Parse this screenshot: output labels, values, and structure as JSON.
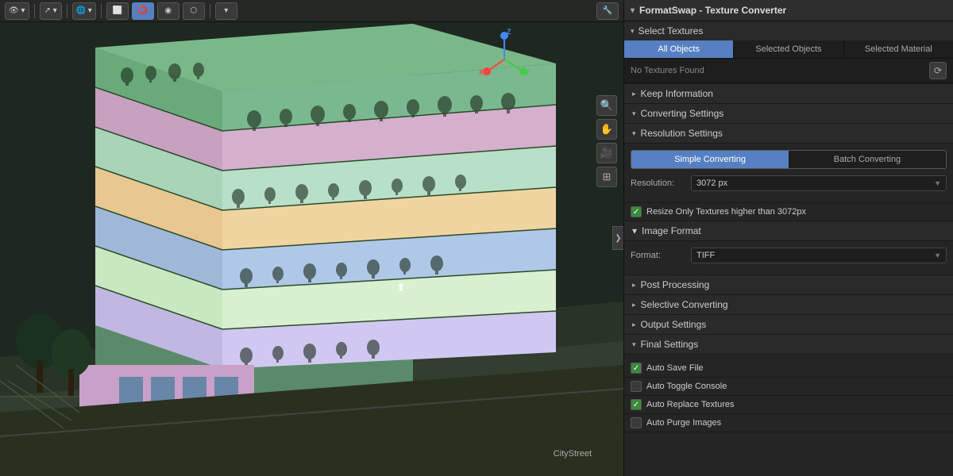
{
  "viewport": {
    "scene_label": "CityStreet"
  },
  "toolbar": {
    "buttons": [
      "👁",
      "↗",
      "🌐",
      "⬜",
      "⭕",
      "◉",
      "⬡",
      "🔧"
    ]
  },
  "sidebar_icons": [
    "🔍",
    "✋",
    "🎥",
    "⊞"
  ],
  "right_panel": {
    "title": "FormatSwap - Texture Converter",
    "select_textures_label": "Select Textures",
    "tabs": [
      {
        "label": "All Objects",
        "active": true
      },
      {
        "label": "Selected Objects",
        "active": false
      },
      {
        "label": "Selected Material",
        "active": false
      }
    ],
    "no_textures_label": "No Textures Found",
    "refresh_icon": "⟳",
    "keep_information_label": "Keep Information",
    "converting_settings_label": "Converting Settings",
    "resolution_settings_label": "Resolution Settings",
    "sub_tabs": [
      {
        "label": "Simple Converting",
        "active": true
      },
      {
        "label": "Batch Converting",
        "active": false
      }
    ],
    "resolution_label": "Resolution:",
    "resolution_value": "3072 px",
    "resize_only_label": "Resize Only Textures higher than 3072px",
    "image_format_label": "Image Format",
    "format_label": "Format:",
    "format_value": "TIFF",
    "format_chevron": "▼",
    "post_processing_label": "Post Processing",
    "selective_converting_label": "Selective Converting",
    "output_settings_label": "Output Settings",
    "final_settings_label": "Final Settings",
    "auto_save_file_label": "Auto Save File",
    "auto_toggle_console_label": "Auto Toggle Console",
    "auto_replace_textures_label": "Auto Replace Textures",
    "auto_purge_images_label": "Auto Purge Images",
    "chevron_down": "▼",
    "chevron_right": "▶",
    "arrow_down": "▾",
    "arrow_right": "▸"
  }
}
